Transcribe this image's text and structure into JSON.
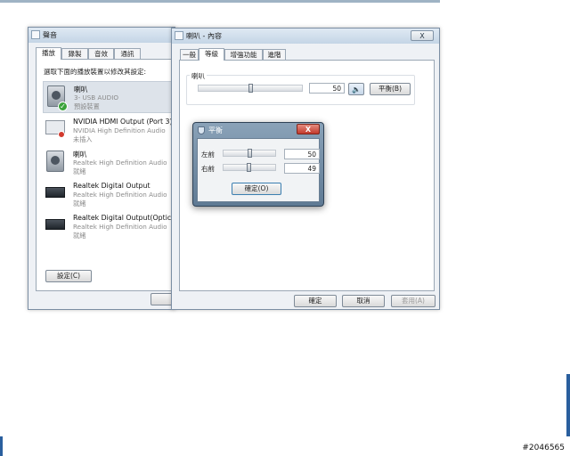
{
  "sound_dialog": {
    "title": "聲音",
    "tabs": [
      "播放",
      "錄製",
      "音效",
      "通訊"
    ],
    "instruction": "選取下面的播放裝置以修改其設定:",
    "devices": [
      {
        "name": "喇叭",
        "line2": "3- USB  AUDIO",
        "line3": "預設裝置"
      },
      {
        "name": "NVIDIA HDMI Output (Port 3)",
        "line2": "NVIDIA High Definition Audio",
        "line3": "未插入"
      },
      {
        "name": "喇叭",
        "line2": "Realtek High Definition Audio",
        "line3": "就緒"
      },
      {
        "name": "Realtek Digital Output",
        "line2": "Realtek High Definition Audio",
        "line3": "就緒"
      },
      {
        "name": "Realtek Digital Output(Optical)",
        "line2": "Realtek High Definition Audio",
        "line3": "就緒"
      }
    ],
    "configure_button": "設定(C)",
    "ok_partial": "確"
  },
  "properties_dialog": {
    "title": "喇叭 - 內容",
    "tabs": [
      "一般",
      "等級",
      "增強功能",
      "進階"
    ],
    "close_glyph": "X",
    "speaker_label": "喇叭",
    "volume": "50",
    "volume_level": 0.5,
    "balance_button": "平衡(B)",
    "ok_button": "確定",
    "cancel_button": "取消",
    "apply_button": "套用(A)"
  },
  "balance_dialog": {
    "title": "平衡",
    "close_glyph": "X",
    "left_label": "左前",
    "left_value": "50",
    "left_level": 0.5,
    "right_label": "右前",
    "right_value": "49",
    "right_level": 0.49,
    "ok_button": "確定(O)"
  },
  "watermark": "#2046565",
  "colors": {
    "selected_row": "#dde3ea",
    "close_button": "#c9483b",
    "titlebar": "#c4d5e6"
  }
}
